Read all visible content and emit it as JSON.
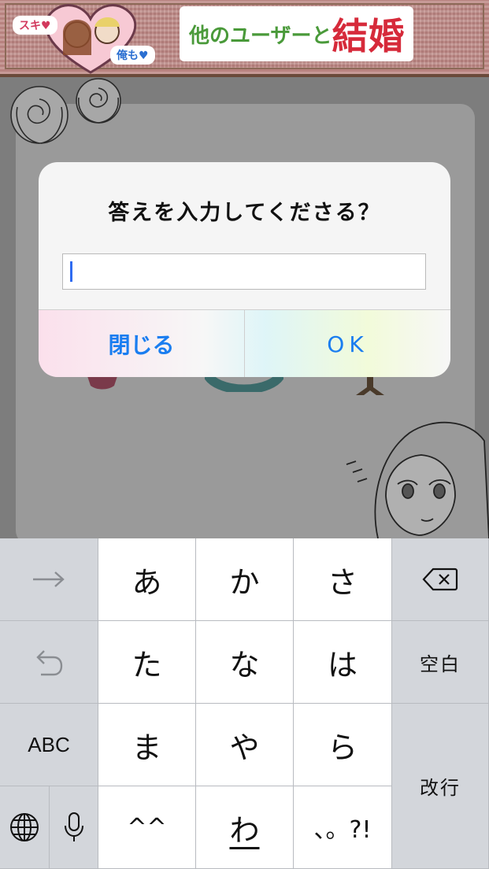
{
  "banner": {
    "bubble_left": "スキ♥",
    "bubble_right": "俺も♥",
    "title_prefix": "他のユーザーと",
    "title_main": "結婚"
  },
  "alert": {
    "title": "答えを入力してくださる？",
    "input_value": "",
    "cancel_label": "閉じる",
    "ok_label": "OK"
  },
  "keyboard": {
    "rows": [
      [
        "あ",
        "か",
        "さ"
      ],
      [
        "た",
        "な",
        "は"
      ],
      [
        "ま",
        "や",
        "ら"
      ],
      [
        "^^",
        "わ",
        "、。?!"
      ]
    ],
    "abc_label": "ABC",
    "space_label": "空白",
    "return_label": "改行",
    "left_column_icons": [
      "arrow-right-icon",
      "undo-icon"
    ],
    "bottom_left_icons": [
      "globe-icon",
      "microphone-icon"
    ],
    "delete_icon": "delete-icon"
  },
  "colors": {
    "accent": "#1a7df0",
    "caret": "#2f6bf1",
    "banner_title_main": "#d62a3a",
    "banner_title_prefix": "#4a9a3a"
  }
}
